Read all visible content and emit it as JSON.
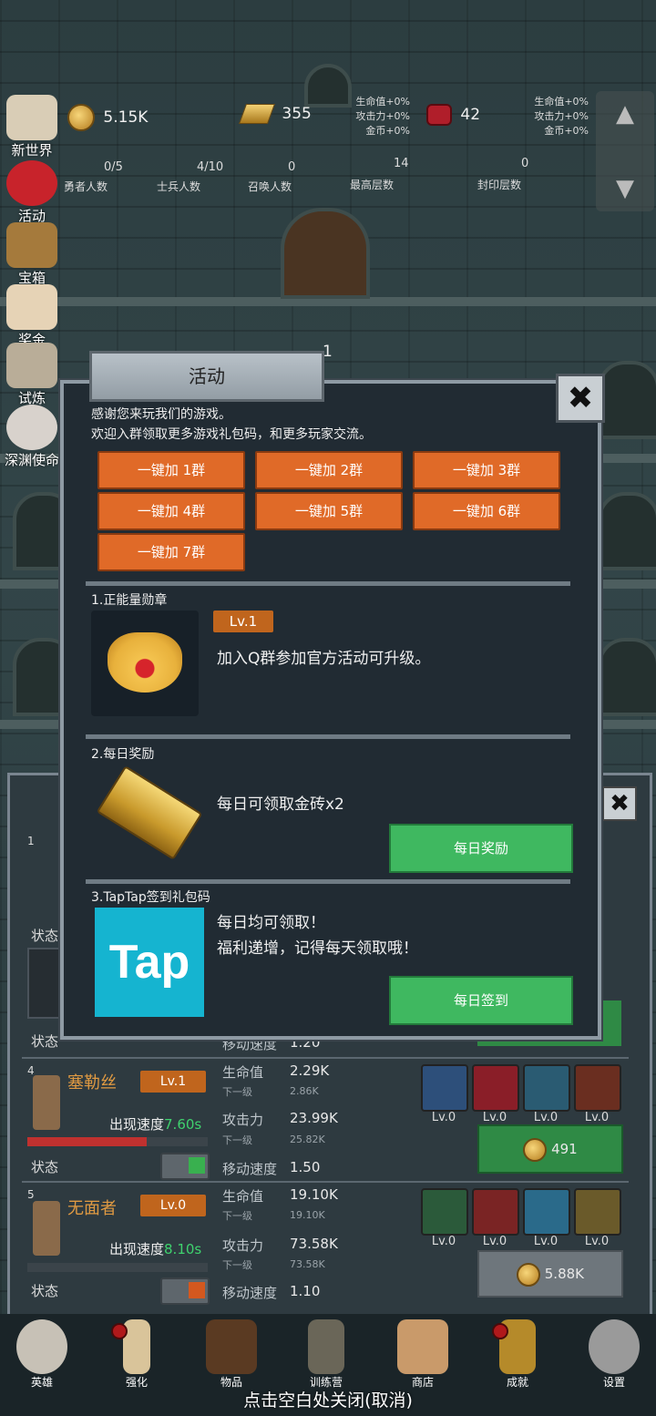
{
  "resources": {
    "gold": "5.15K",
    "gold_bar": "355",
    "gem": "42",
    "bonus_left": [
      "生命值+0%",
      "攻击力+0%",
      "金币+0%"
    ],
    "bonus_right": [
      "生命值+0%",
      "攻击力+0%",
      "金币+0%"
    ]
  },
  "counters": [
    {
      "label": "勇者人数",
      "value": "0/5"
    },
    {
      "label": "士兵人数",
      "value": "4/10"
    },
    {
      "label": "召唤人数",
      "value": "0"
    },
    {
      "label": "最高层数",
      "value": "14"
    },
    {
      "label": "封印层数",
      "value": "0"
    }
  ],
  "floor_number": "1",
  "sidebar": [
    "新世界",
    "活动",
    "宝箱",
    "奖金",
    "试炼",
    "深渊使命"
  ],
  "dialog": {
    "title": "活动",
    "intro_line1": "感谢您来玩我们的游戏。",
    "intro_line2": "欢迎入群领取更多游戏礼包码，和更多玩家交流。",
    "group_buttons": [
      "一键加 1群",
      "一键加 2群",
      "一键加 3群",
      "一键加 4群",
      "一键加 5群",
      "一键加 6群",
      "一键加 7群"
    ],
    "section1_title": "1.正能量勋章",
    "medal_level": "Lv.1",
    "medal_desc": "加入Q群参加官方活动可升级。",
    "section2_title": "2.每日奖励",
    "daily_desc": "每日可领取金砖x2",
    "daily_button": "每日奖励",
    "section3_title": "3.TapTap签到礼包码",
    "tap_desc1": "每日均可领取！",
    "tap_desc2": "福利递增，记得每天领取哦！",
    "tap_logo": "Tap",
    "tap_button": "每日签到"
  },
  "heroes": [
    {
      "index": "1",
      "status_label": "状态"
    },
    {
      "index": "",
      "status_label": "状态",
      "speed_label": "移动速度",
      "speed": "1.20"
    },
    {
      "index": "4",
      "name": "塞勒丝",
      "level": "Lv.1",
      "appear_label": "出现速度",
      "appear": "7.60s",
      "hp_label": "生命值",
      "hp": "2.29K",
      "next_label": "下一级",
      "hp_next": "2.86K",
      "atk_label": "攻击力",
      "atk": "23.99K",
      "atk_next": "25.82K",
      "speed_label": "移动速度",
      "speed": "1.50",
      "status_label": "状态",
      "skills": [
        "Lv.0",
        "Lv.0",
        "Lv.0",
        "Lv.0"
      ],
      "cost": "491"
    },
    {
      "index": "5",
      "name": "无面者",
      "level": "Lv.0",
      "appear_label": "出现速度",
      "appear": "8.10s",
      "hp_label": "生命值",
      "hp": "19.10K",
      "next_label": "下一级",
      "hp_next": "19.10K",
      "atk_label": "攻击力",
      "atk": "73.58K",
      "atk_next": "73.58K",
      "speed_label": "移动速度",
      "speed": "1.10",
      "status_label": "状态",
      "skills": [
        "Lv.0",
        "Lv.0",
        "Lv.0",
        "Lv.0"
      ],
      "cost": "5.88K"
    }
  ],
  "nav": [
    "英雄",
    "强化",
    "物品",
    "训练营",
    "商店",
    "成就",
    "设置"
  ],
  "close_hint": "点击空白处关闭(取消)",
  "colors": {
    "accent_orange": "#e06a28",
    "accent_green": "#3fb860",
    "tap_blue": "#15b4d0"
  }
}
